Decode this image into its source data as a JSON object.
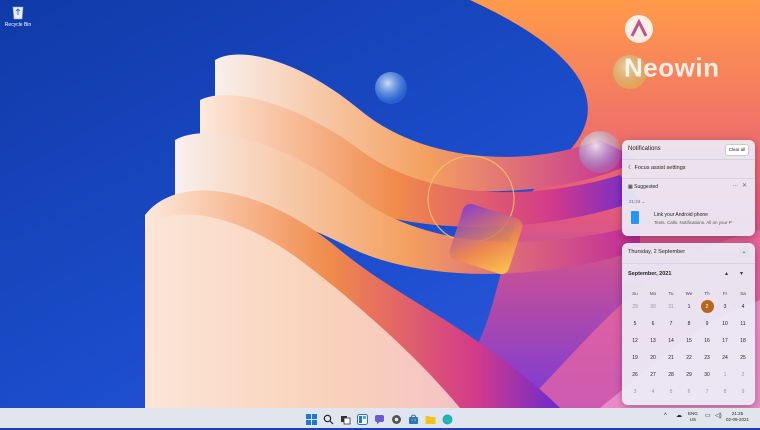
{
  "desktop": {
    "recycle_bin_label": "Recycle Bin"
  },
  "watermark": {
    "text": "Neowin"
  },
  "notifications": {
    "title": "Notifications",
    "clear_all": "Clear all",
    "focus_assist": "Focus assist settings",
    "suggested": "Suggested",
    "time": "21:24",
    "card_title": "Link your Android phone",
    "card_body": "Texts. Calls. Notifications. All on your P"
  },
  "calendar": {
    "date_header": "Thursday, 2 September",
    "month_label": "September, 2021",
    "weekdays": [
      "Su",
      "Mo",
      "Tu",
      "We",
      "Th",
      "Fr",
      "Sa"
    ],
    "days": [
      [
        "29",
        "30",
        "31",
        "1",
        "2",
        "3",
        "4"
      ],
      [
        "5",
        "6",
        "7",
        "8",
        "9",
        "10",
        "11"
      ],
      [
        "12",
        "13",
        "14",
        "15",
        "16",
        "17",
        "18"
      ],
      [
        "19",
        "20",
        "21",
        "22",
        "23",
        "24",
        "25"
      ],
      [
        "26",
        "27",
        "28",
        "29",
        "30",
        "1",
        "2"
      ],
      [
        "3",
        "4",
        "5",
        "6",
        "7",
        "8",
        "9"
      ]
    ],
    "today": "2"
  },
  "taskbar": {
    "lang_line1": "ENG",
    "lang_line2": "US",
    "time": "21:25",
    "date": "02-09-2021",
    "icons": [
      "windows-icon",
      "search-icon",
      "task-view-icon",
      "widgets-icon",
      "chat-icon",
      "settings-icon",
      "store-icon",
      "file-explorer-icon",
      "edge-icon"
    ]
  },
  "colors": {
    "accent_today": "#b5651d",
    "desktop_blue": "#1b3fb8"
  }
}
